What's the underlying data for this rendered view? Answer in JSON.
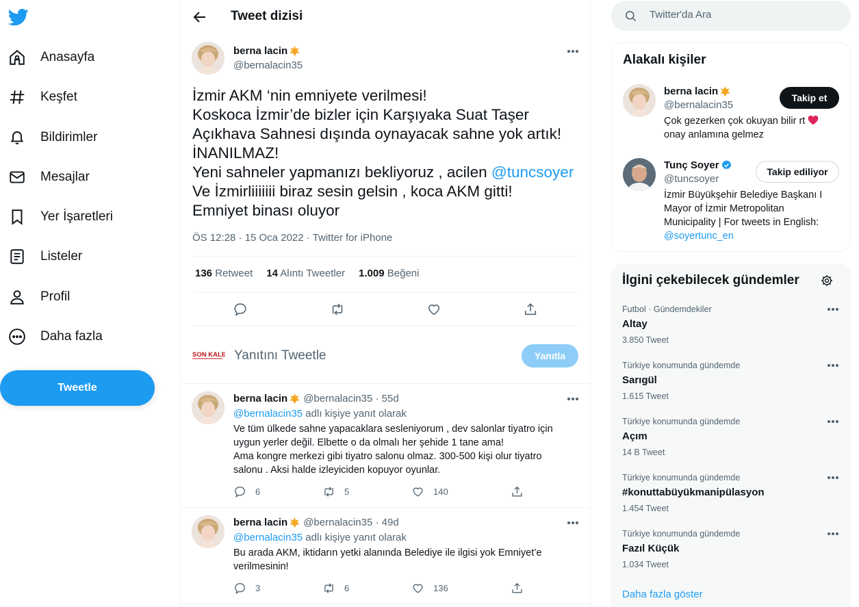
{
  "nav": {
    "items": [
      {
        "label": "Anasayfa",
        "icon": "home-icon"
      },
      {
        "label": "Keşfet",
        "icon": "hashtag-icon"
      },
      {
        "label": "Bildirimler",
        "icon": "bell-icon"
      },
      {
        "label": "Mesajlar",
        "icon": "envelope-icon"
      },
      {
        "label": "Yer İşaretleri",
        "icon": "bookmark-icon"
      },
      {
        "label": "Listeler",
        "icon": "list-icon"
      },
      {
        "label": "Profil",
        "icon": "person-icon"
      },
      {
        "label": "Daha fazla",
        "icon": "more-circle-icon"
      }
    ],
    "tweet_button": "Tweetle"
  },
  "header": {
    "title": "Tweet dizisi"
  },
  "main_tweet": {
    "name": "berna lacin",
    "handle": "@bernalacin35",
    "lines": [
      "İzmir AKM ‘nin emniyete verilmesi!",
      "Koskoca İzmir’de bizler için Karşıyaka Suat Taşer",
      "Açıkhava Sahnesi dışında oynayacak sahne yok artık!",
      "İNANILMAZ!",
      "Yeni sahneler yapmanızı bekliyoruz , acilen "
    ],
    "mention": "@tuncsoyer",
    "lines_after": [
      "Ve İzmirliiiiiii biraz sesin gelsin , koca AKM gitti!",
      "Emniyet binası oluyor"
    ],
    "meta": "ÖS 12:28 · 15 Oca 2022 · Twitter for iPhone",
    "stats": {
      "retweets": "136",
      "retweets_label": "Retweet",
      "quotes": "14",
      "quotes_label": "Alıntı Tweetler",
      "likes": "1.009",
      "likes_label": "Beğeni"
    }
  },
  "composer": {
    "logo_text": "SON KALE",
    "placeholder": "Yanıtını Tweetle",
    "reply_button": "Yanıtla"
  },
  "replies": [
    {
      "name": "berna lacin",
      "handle_time": "@bernalacin35 · 55d",
      "reply_to_handle": "@bernalacin35",
      "reply_to_suffix": " adlı kişiye yanıt olarak",
      "lines": [
        "Ve tüm ülkede sahne yapacaklara sesleniyorum , dev salonlar tiyatro için",
        "uygun yerler değil. Elbette o da olmalı her şehide 1 tane ama!",
        "Ama kongre merkezi gibi tiyatro salonu olmaz. 300-500 kişi olur tiyatro",
        "salonu . Aksi halde izleyiciden kopuyor oyunlar."
      ],
      "replies": "6",
      "retweets": "5",
      "likes": "140"
    },
    {
      "name": "berna lacin",
      "handle_time": "@bernalacin35 · 49d",
      "reply_to_handle": "@bernalacin35",
      "reply_to_suffix": " adlı kişiye yanıt olarak",
      "lines": [
        "Bu arada AKM, iktidarın yetki alanında Belediye ile ilgisi yok Emniyet’e",
        "verilmesinin!"
      ],
      "replies": "3",
      "retweets": "6",
      "likes": "136"
    }
  ],
  "search": {
    "placeholder": "Twitter'da Ara"
  },
  "related": {
    "title": "Alakalı kişiler",
    "people": [
      {
        "name": "berna lacin",
        "handle": "@bernalacin35",
        "bio_lines": [
          "Çok gezerken çok okuyan bilir rt ",
          "onay anlamına gelmez"
        ],
        "button": "Takip et"
      },
      {
        "name": "Tunç Soyer",
        "handle": "@tuncsoyer",
        "bio_lines": [
          "İzmir Büyükşehir Belediye Başkanı I",
          "Mayor of İzmir Metropolitan",
          "Municipality | For tweets in English:"
        ],
        "bio_link": "@soyertunc_en",
        "button": "Takip ediliyor"
      }
    ]
  },
  "trends": {
    "title": "İlgini çekebilecek gündemler",
    "items": [
      {
        "context": "Futbol · Gündemdekiler",
        "title": "Altay",
        "count": "3.850 Tweet"
      },
      {
        "context": "Türkiye konumunda gündemde",
        "title": "Sarıgül",
        "count": "1.615 Tweet"
      },
      {
        "context": "Türkiye konumunda gündemde",
        "title": "Açım",
        "count": "14 B Tweet"
      },
      {
        "context": "Türkiye konumunda gündemde",
        "title": "#konuttabüyükmanipülasyon",
        "count": "1.454 Tweet"
      },
      {
        "context": "Türkiye konumunda gündemde",
        "title": "Fazıl Küçük",
        "count": "1.034 Tweet"
      }
    ],
    "show_more": "Daha fazla göster"
  },
  "colors": {
    "accent": "#1d9bf0",
    "text": "#0f1419",
    "muted": "#536471",
    "star": "#f5a623",
    "verified": "#1d9bf0",
    "heart": "#e0245e"
  }
}
